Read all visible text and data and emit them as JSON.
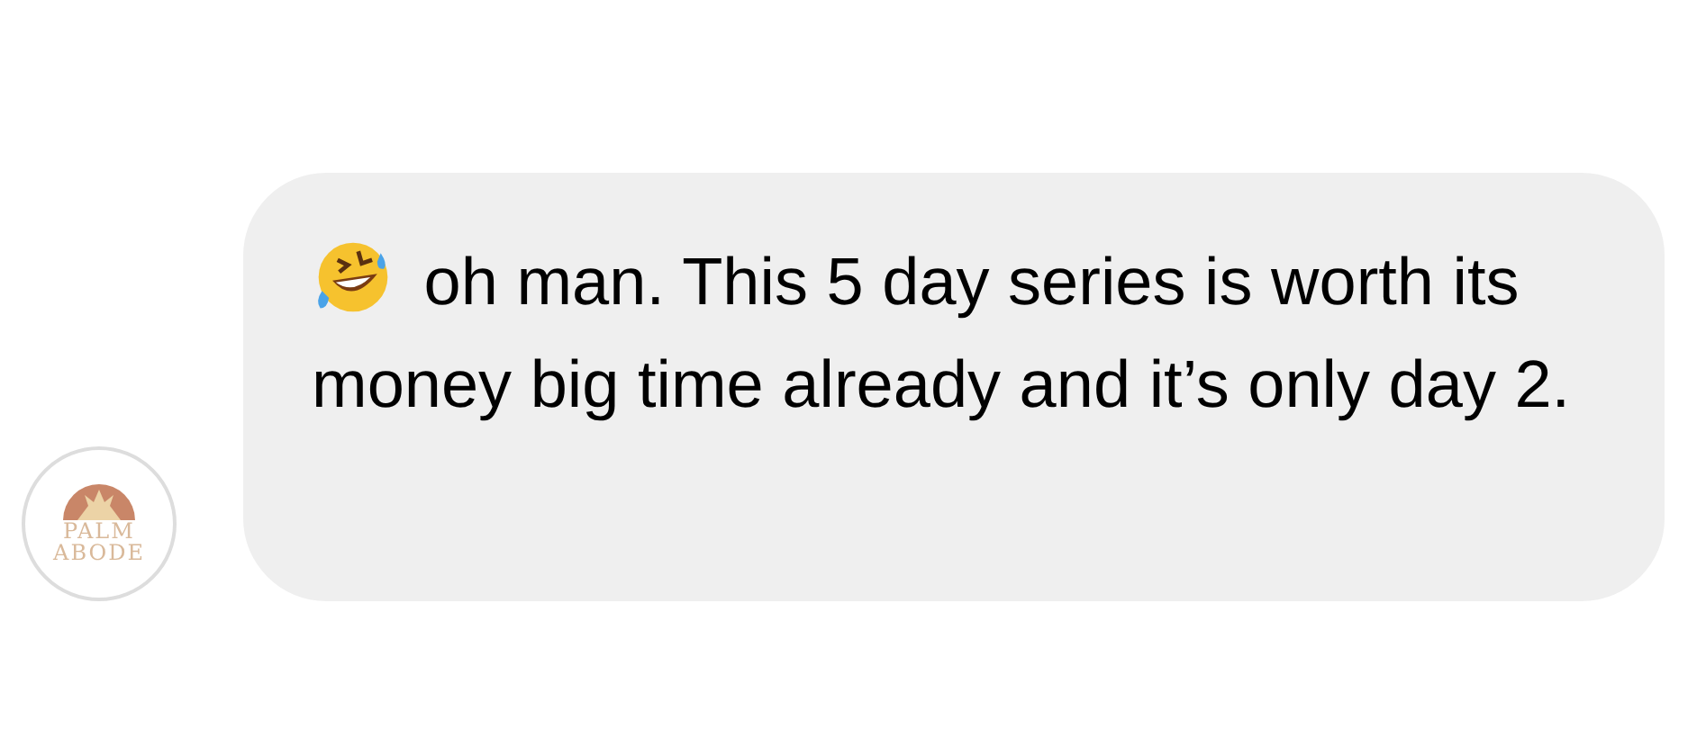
{
  "avatar": {
    "lines": [
      "PALM",
      "ABODE"
    ]
  },
  "message": {
    "text": "oh man. This 5 day series is worth its money big time already and it’s only day 2."
  }
}
